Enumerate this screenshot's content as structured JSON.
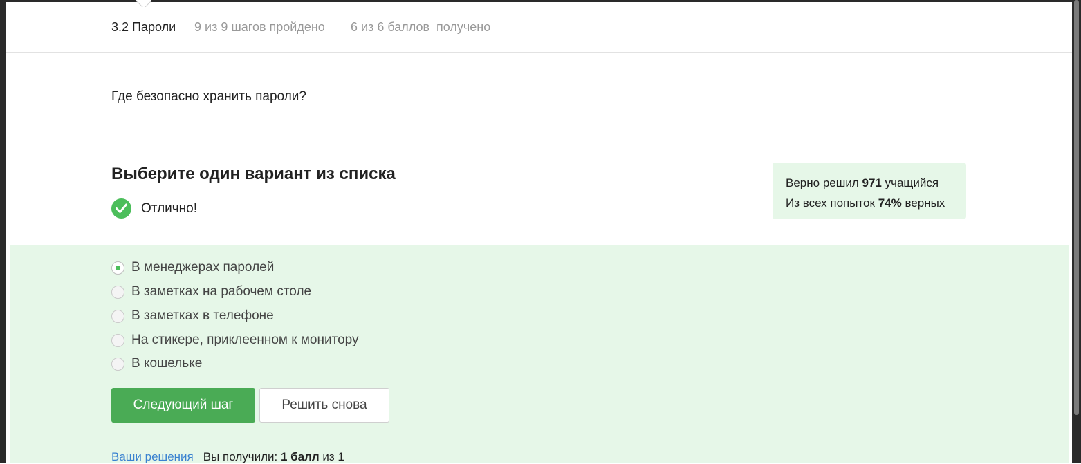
{
  "header": {
    "lesson_title": "3.2 Пароли",
    "steps_progress": "9 из 9 шагов пройдено",
    "score_progress": "6 из 6 баллов  получено"
  },
  "question": "Где безопасно хранить пароли?",
  "quiz": {
    "title": "Выберите один вариант из списка",
    "result_text": "Отлично!"
  },
  "stats": {
    "line1_prefix": "Верно решил ",
    "line1_value": "971",
    "line1_suffix": " учащийся",
    "line2_prefix": "Из всех попыток ",
    "line2_value": "74%",
    "line2_suffix": " верных"
  },
  "options": [
    {
      "label": "В менеджерах паролей",
      "selected": true
    },
    {
      "label": "В заметках на рабочем столе",
      "selected": false
    },
    {
      "label": "В заметках в телефоне",
      "selected": false
    },
    {
      "label": "На стикере, приклеенном к монитору",
      "selected": false
    },
    {
      "label": "В кошельке",
      "selected": false
    }
  ],
  "buttons": {
    "next_step": "Следующий шаг",
    "solve_again": "Решить снова"
  },
  "footer": {
    "solutions_link": "Ваши решения",
    "received_prefix": "Вы получили: ",
    "received_value": "1 балл",
    "received_suffix": " из 1"
  },
  "colors": {
    "accent_green": "#4aab55",
    "panel_green": "#e6f7e8",
    "link_blue": "#3a82d0"
  }
}
